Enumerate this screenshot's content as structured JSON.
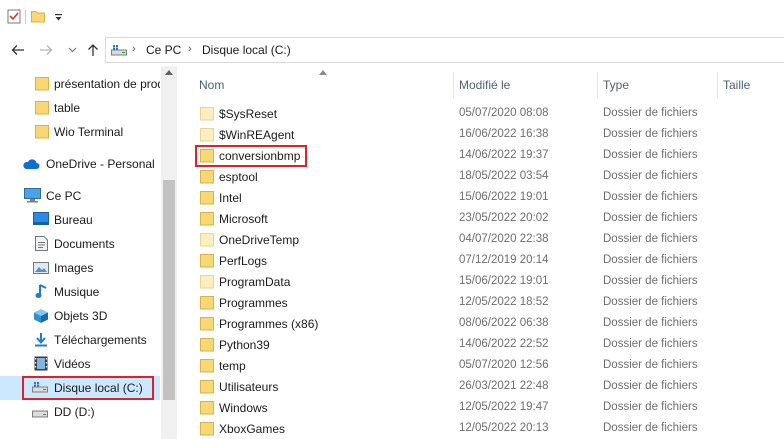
{
  "address": {
    "crumbs": [
      "Ce PC",
      "Disque local (C:)"
    ]
  },
  "sidebar": {
    "items": [
      {
        "label": "présentation de prod",
        "icon": "folder-icon"
      },
      {
        "label": "table",
        "icon": "folder-icon"
      },
      {
        "label": "Wio Terminal",
        "icon": "folder-icon"
      },
      {
        "label": "OneDrive - Personal",
        "icon": "cloud-icon"
      },
      {
        "label": "Ce PC",
        "icon": "computer-icon"
      },
      {
        "label": "Bureau",
        "icon": "desktop-icon"
      },
      {
        "label": "Documents",
        "icon": "documents-icon"
      },
      {
        "label": "Images",
        "icon": "images-icon"
      },
      {
        "label": "Musique",
        "icon": "music-icon"
      },
      {
        "label": "Objets 3D",
        "icon": "objects-3d-icon"
      },
      {
        "label": "Téléchargements",
        "icon": "downloads-icon"
      },
      {
        "label": "Vidéos",
        "icon": "videos-icon"
      },
      {
        "label": "Disque local (C:)",
        "icon": "local-disk-icon",
        "selected": true
      },
      {
        "label": "DD (D:)",
        "icon": "drive-icon"
      }
    ]
  },
  "columns": {
    "name": "Nom",
    "modified": "Modifié le",
    "type": "Type",
    "size": "Taille"
  },
  "files": [
    {
      "name": "$SysReset",
      "modified": "05/07/2020 08:08",
      "type": "Dossier de fichiers",
      "faded": true
    },
    {
      "name": "$WinREAgent",
      "modified": "16/06/2022 16:38",
      "type": "Dossier de fichiers",
      "faded": true
    },
    {
      "name": "conversionbmp",
      "modified": "14/06/2022 19:37",
      "type": "Dossier de fichiers"
    },
    {
      "name": "esptool",
      "modified": "18/05/2022 03:54",
      "type": "Dossier de fichiers"
    },
    {
      "name": "Intel",
      "modified": "15/06/2022 19:01",
      "type": "Dossier de fichiers"
    },
    {
      "name": "Microsoft",
      "modified": "23/05/2022 20:02",
      "type": "Dossier de fichiers"
    },
    {
      "name": "OneDriveTemp",
      "modified": "04/07/2020 22:38",
      "type": "Dossier de fichiers",
      "faded": true
    },
    {
      "name": "PerfLogs",
      "modified": "07/12/2019 20:14",
      "type": "Dossier de fichiers"
    },
    {
      "name": "ProgramData",
      "modified": "15/06/2022 19:01",
      "type": "Dossier de fichiers",
      "faded": true
    },
    {
      "name": "Programmes",
      "modified": "12/05/2022 18:52",
      "type": "Dossier de fichiers"
    },
    {
      "name": "Programmes (x86)",
      "modified": "08/06/2022 06:38",
      "type": "Dossier de fichiers"
    },
    {
      "name": "Python39",
      "modified": "14/06/2022 22:52",
      "type": "Dossier de fichiers"
    },
    {
      "name": "temp",
      "modified": "05/07/2020 12:56",
      "type": "Dossier de fichiers"
    },
    {
      "name": "Utilisateurs",
      "modified": "26/03/2021 22:48",
      "type": "Dossier de fichiers"
    },
    {
      "name": "Windows",
      "modified": "12/05/2022 19:47",
      "type": "Dossier de fichiers"
    },
    {
      "name": "XboxGames",
      "modified": "12/05/2022 20:13",
      "type": "Dossier de fichiers"
    }
  ],
  "colors": {
    "folder": "#f8d775",
    "folder_faded": "#fbeebf",
    "highlight": "#e0202a",
    "selection": "#cce8ff",
    "header_text": "#4c607a"
  }
}
